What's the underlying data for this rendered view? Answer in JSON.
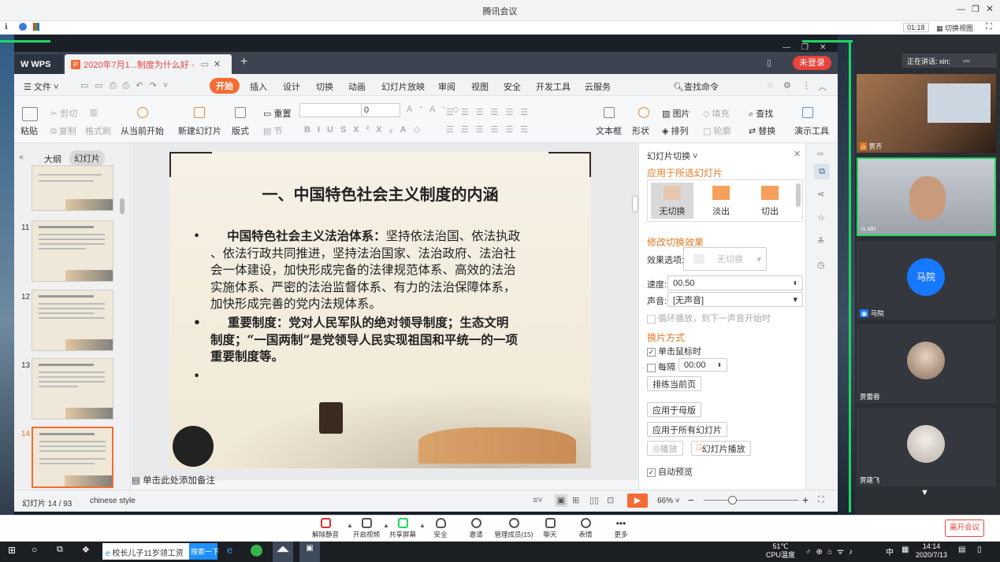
{
  "meeting": {
    "title": "腾讯会议",
    "timer": "01:18",
    "switch_view": "切换视图",
    "speaker_label": "正在讲话: xin;",
    "toolbar": [
      {
        "label": "解除静音",
        "icon": "mic-muted-icon"
      },
      {
        "label": "开启视频",
        "icon": "camera-off-icon"
      },
      {
        "label": "共享屏幕",
        "icon": "share-screen-icon"
      },
      {
        "label": "安全",
        "icon": "shield-icon"
      },
      {
        "label": "邀请",
        "icon": "invite-icon"
      },
      {
        "label": "管理成员(15)",
        "icon": "members-icon"
      },
      {
        "label": "聊天",
        "icon": "chat-icon"
      },
      {
        "label": "表情",
        "icon": "emoji-icon"
      },
      {
        "label": "更多",
        "icon": "more-icon"
      }
    ],
    "leave_button": "离开会议",
    "participants": [
      {
        "name": "贾齐",
        "type": "video"
      },
      {
        "name": "xin",
        "type": "video"
      },
      {
        "name": "马院",
        "type": "avatar",
        "avatar_text": "马院",
        "color": "#1677ff"
      },
      {
        "name": "贾蕾蓉",
        "type": "photo"
      },
      {
        "name": "贾建飞",
        "type": "photo"
      }
    ]
  },
  "wps": {
    "app_tab": "WPS",
    "doc_tab": "2020年7月1...制度为什么好 -",
    "login_button": "未登录",
    "menu": [
      "文件",
      "开始",
      "插入",
      "设计",
      "切换",
      "动画",
      "幻灯片放映",
      "审阅",
      "视图",
      "安全",
      "开发工具",
      "云服务"
    ],
    "active_menu": "开始",
    "search_command": "查找命令",
    "ribbon": {
      "paste": "粘贴",
      "cut": "剪切",
      "copy": "复制",
      "format_painter": "格式刷",
      "from_current": "从当前开始",
      "new_slide": "新建幻灯片",
      "layout": "版式",
      "reset": "重置",
      "section": "节",
      "font_size": "0",
      "textbox": "文本框",
      "shape": "形状",
      "picture": "图片",
      "arrange": "排列",
      "fill": "填充",
      "outline": "轮廓",
      "find": "查找",
      "replace": "替换",
      "present_tools": "演示工具"
    },
    "panel_tabs": [
      "大纲",
      "幻灯片"
    ],
    "active_panel_tab": "幻灯片",
    "thumbnail_numbers": [
      "11",
      "12",
      "13",
      "14"
    ],
    "slide": {
      "title": "一、中国特色社会主义制度的内涵",
      "bullet1_lead": "中国特色社会主义法治体系：",
      "bullet1_lines": [
        "坚持依法治国、依法执政",
        "、依法行政共同推进，坚持法治国家、法治政府、法治社",
        "会一体建设，加快形成完备的法律规范体系、高效的法治",
        "实施体系、严密的法治监督体系、有力的法治保障体系，",
        "加快形成完善的党内法规体系。"
      ],
      "bullet2_lines": [
        "重要制度：党对人民军队的绝对领导制度；生态文明",
        "制度；“一国两制”是党领导人民实现祖国和平统一的一项",
        "重要制度等。"
      ],
      "bullet_char": "•"
    },
    "notes_placeholder": "单击此处添加备注",
    "transition_pane": {
      "title": "幻灯片切换",
      "apply_selected": "应用于所选幻灯片",
      "effects": [
        "无切换",
        "淡出",
        "切出"
      ],
      "modify_effect": "修改切换效果",
      "effect_option_label": "效果选项:",
      "effect_option_value": "无切换",
      "speed_label": "速度:",
      "speed_value": "00.50",
      "sound_label": "声音:",
      "sound_value": "[无声音]",
      "loop_sound": "循环播放，到下一声音开始时",
      "advance_section": "换片方式",
      "on_click": "单击鼠标时",
      "every": "每隔",
      "every_value": "00:00",
      "rehearse": "排练当前页",
      "apply_master": "应用于母版",
      "apply_all": "应用于所有幻灯片",
      "play": "播放",
      "slideshow": "幻灯片播放",
      "auto_preview": "自动预览"
    },
    "status": {
      "slide_counter": "幻灯片 14 / 93",
      "theme": "chinese style",
      "zoom": "66%"
    }
  },
  "taskbar": {
    "browser_task": "校长儿子11岁领工资",
    "search_btn": "搜索一下",
    "weather_temp": "51℃",
    "weather_label": "CPU温度",
    "ime": "中",
    "time": "14:14",
    "date": "2020/7/13"
  },
  "colors": {
    "accent_orange": "#e87722",
    "wps_tab_orange": "#f46b35",
    "login_red": "#e8433a",
    "meeting_blue": "#1677ff"
  }
}
